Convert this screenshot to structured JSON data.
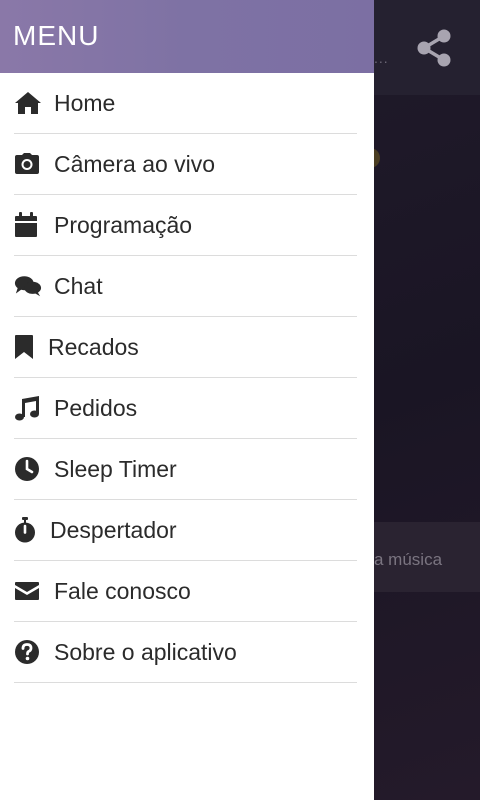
{
  "menu": {
    "title": "MENU",
    "items": [
      {
        "label": "Home",
        "icon": "home-icon"
      },
      {
        "label": "Câmera ao vivo",
        "icon": "camera-icon"
      },
      {
        "label": "Programação",
        "icon": "calendar-icon"
      },
      {
        "label": "Chat",
        "icon": "chat-icon"
      },
      {
        "label": "Recados",
        "icon": "bookmark-icon"
      },
      {
        "label": "Pedidos",
        "icon": "music-icon"
      },
      {
        "label": "Sleep Timer",
        "icon": "clock-icon"
      },
      {
        "label": "Despertador",
        "icon": "stopwatch-icon"
      },
      {
        "label": "Fale conosco",
        "icon": "envelope-icon"
      },
      {
        "label": "Sobre o aplicativo",
        "icon": "question-icon"
      }
    ]
  },
  "background": {
    "now_playing_text": "a música",
    "header_dots": "...",
    "share_icon": "share-icon"
  },
  "colors": {
    "menu_header": "#7e72a4",
    "text": "#2b2b2b",
    "divider": "#dcdcdc"
  }
}
